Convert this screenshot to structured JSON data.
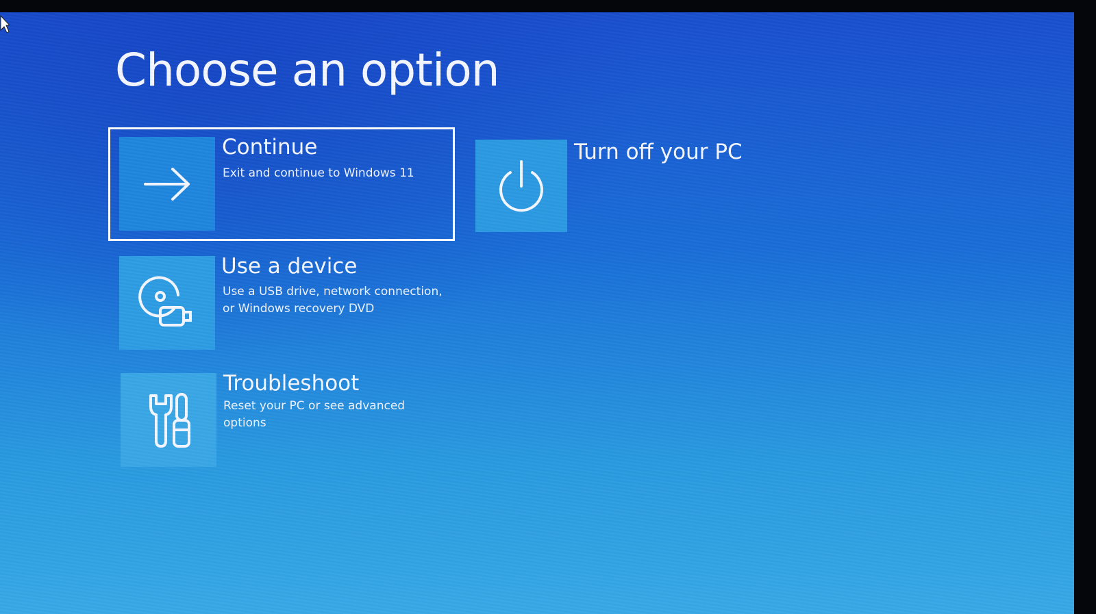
{
  "page_title": "Choose an option",
  "options": [
    {
      "id": "continue",
      "title": "Continue",
      "description": "Exit and continue to Windows 11",
      "icon": "arrow-right-icon",
      "selected": true
    },
    {
      "id": "turn-off",
      "title": "Turn off your PC",
      "description": "",
      "icon": "power-icon",
      "selected": false
    },
    {
      "id": "use-device",
      "title": "Use a device",
      "description": "Use a USB drive, network connection, or Windows recovery DVD",
      "icon": "usb-disc-icon",
      "selected": false
    },
    {
      "id": "troubleshoot",
      "title": "Troubleshoot",
      "description": "Reset your PC or see advanced options",
      "icon": "tools-icon",
      "selected": false
    }
  ],
  "colors": {
    "background_top": "#1a4fcf",
    "background_bottom": "#38a9e6",
    "tile": "#2a8fe0",
    "text": "#f4f7ff"
  }
}
